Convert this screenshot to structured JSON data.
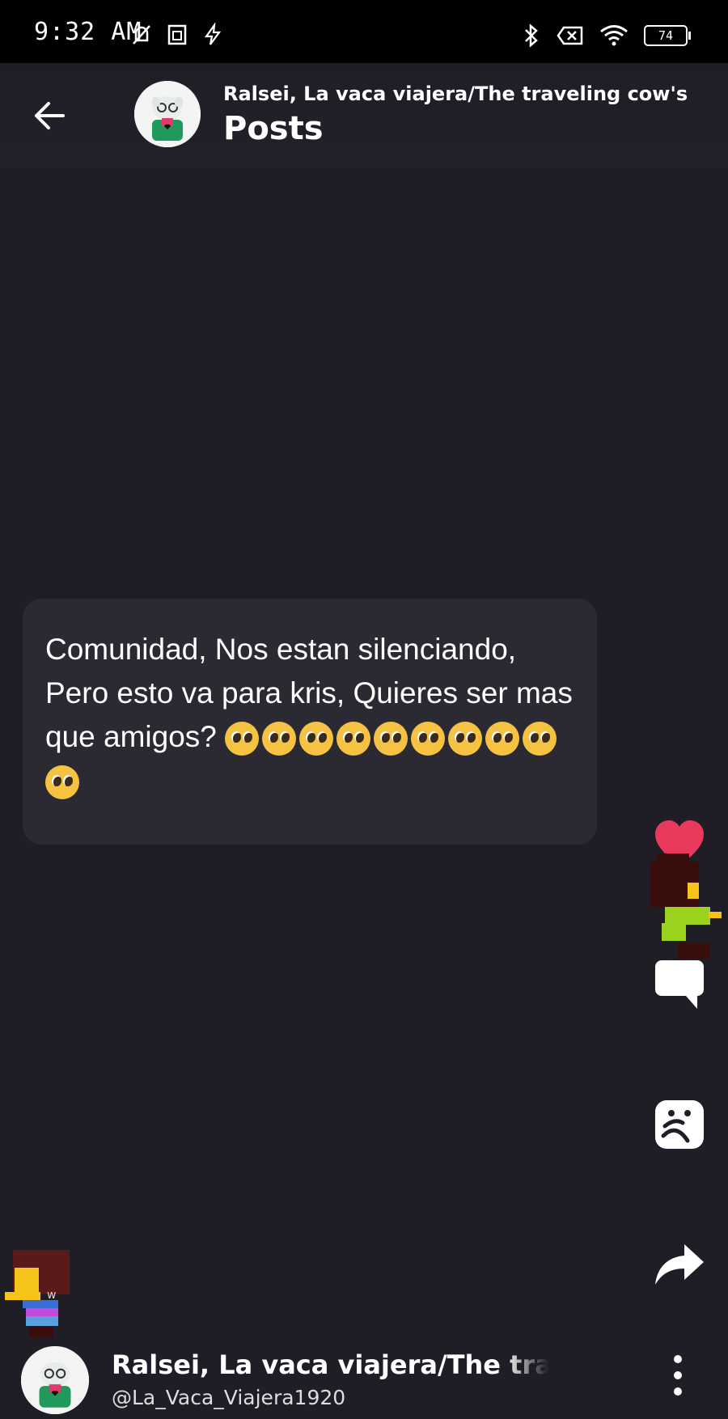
{
  "status_bar": {
    "time": "9:32 AM",
    "battery": "74",
    "icons_left": [
      "mute-icon",
      "sim-icon",
      "flash-icon"
    ],
    "icons_right": [
      "bluetooth-icon",
      "no-sim-icon",
      "wifi-icon",
      "battery-icon"
    ]
  },
  "header": {
    "subtitle": "Ralsei, La vaca viajera/The traveling cow's",
    "title": "Posts",
    "back_icon": "arrow-left-icon"
  },
  "post": {
    "text": "Comunidad, Nos estan silenciando, Pero esto va para kris, Quieres ser mas que amigos?",
    "emoji": "pleading-face",
    "emoji_count": 10
  },
  "actions": [
    {
      "name": "like",
      "icon": "heart-icon",
      "color": "#e9395c"
    },
    {
      "name": "comment",
      "icon": "comment-icon",
      "color": "#ffffff"
    },
    {
      "name": "tip",
      "icon": "props-icon",
      "color": "#ffffff"
    },
    {
      "name": "share",
      "icon": "share-icon",
      "color": "#ffffff"
    }
  ],
  "author": {
    "name": "Ralsei, La vaca viajera/The travel",
    "handle": "@La_Vaca_Viajera1920"
  },
  "colors": {
    "background": "#1f1e26",
    "card": "#2b2a33",
    "like": "#e9395c"
  }
}
